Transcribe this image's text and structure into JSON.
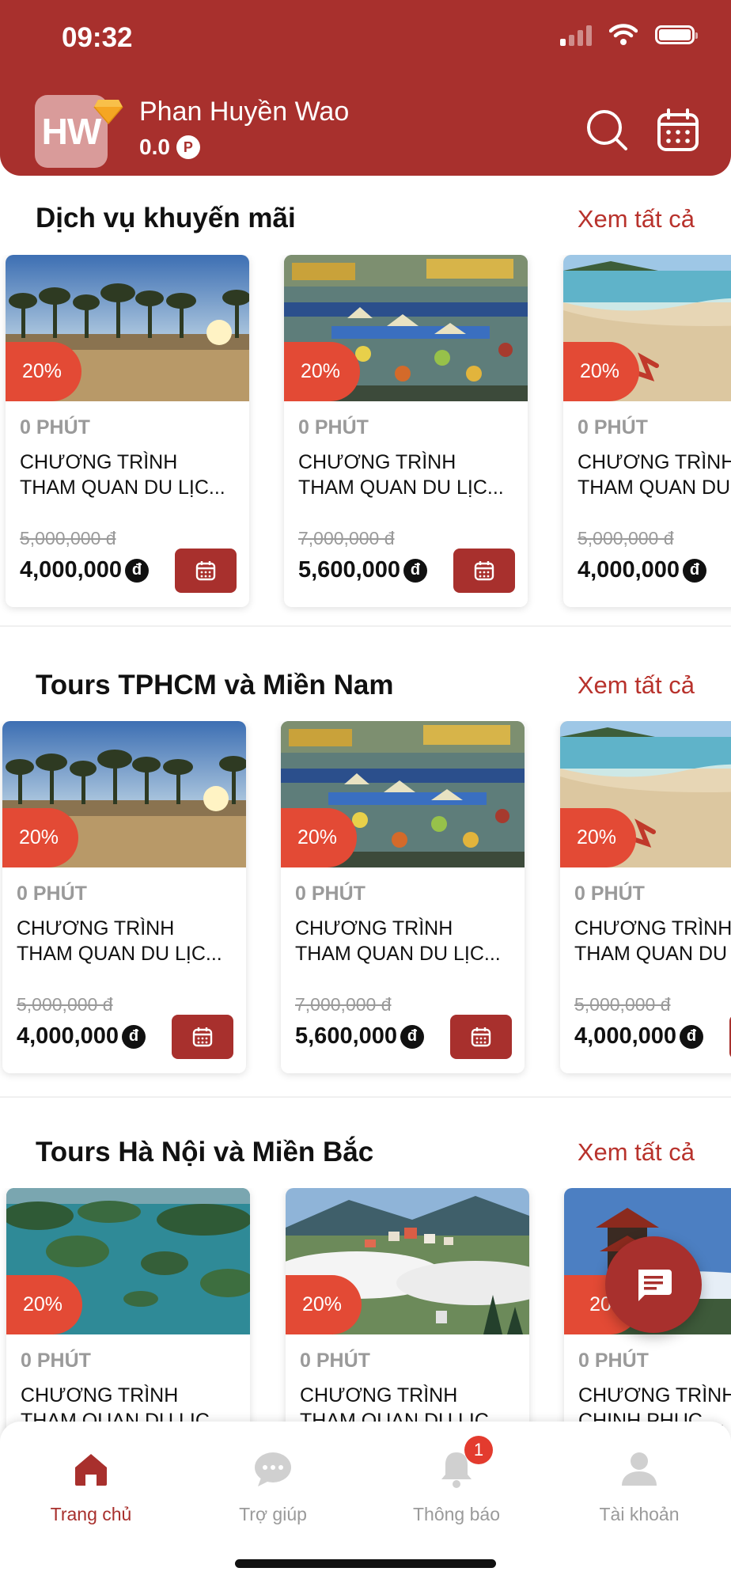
{
  "status_bar": {
    "time": "09:32"
  },
  "header": {
    "avatar_initials": "HW",
    "user_name": "Phan Huyền Wao",
    "points": "0.0",
    "points_symbol": "P"
  },
  "sections": [
    {
      "title": "Dịch vụ khuyến mãi",
      "see_all": "Xem tất cả",
      "cards": [
        {
          "image": "pine-forest-sunrise",
          "discount": "20%",
          "duration": "0 PHÚT",
          "title": "CHƯƠNG TRÌNH\nTHAM QUAN DU LỊC...",
          "price_old": "5,000,000 đ",
          "price_new": "4,000,000",
          "currency": "đ"
        },
        {
          "image": "floating-market",
          "discount": "20%",
          "duration": "0 PHÚT",
          "title": "CHƯƠNG TRÌNH\nTHAM QUAN DU LỊC...",
          "price_old": "7,000,000 đ",
          "price_new": "5,600,000",
          "currency": "đ"
        },
        {
          "image": "beach",
          "discount": "20%",
          "duration": "0 PHÚT",
          "title": "CHƯƠNG TRÌNH\nTHAM QUAN DU",
          "price_old": "5,000,000 đ",
          "price_new": "4,000,000",
          "currency": "đ"
        }
      ]
    },
    {
      "title": "Tours TPHCM và Miền Nam",
      "see_all": "Xem tất cả",
      "cards": [
        {
          "image": "pine-forest-sunrise",
          "discount": "20%",
          "duration": "0 PHÚT",
          "title": "CHƯƠNG TRÌNH\nTHAM QUAN DU LỊC...",
          "price_old": "5,000,000 đ",
          "price_new": "4,000,000",
          "currency": "đ"
        },
        {
          "image": "floating-market",
          "discount": "20%",
          "duration": "0 PHÚT",
          "title": "CHƯƠNG TRÌNH\nTHAM QUAN DU LỊC...",
          "price_old": "7,000,000 đ",
          "price_new": "5,600,000",
          "currency": "đ"
        },
        {
          "image": "beach",
          "discount": "20%",
          "duration": "0 PHÚT",
          "title": "CHƯƠNG TRÌNH\nTHAM QUAN DU",
          "price_old": "5,000,000 đ",
          "price_new": "4,000,000",
          "currency": "đ"
        }
      ]
    },
    {
      "title": "Tours Hà Nội và Miền Bắc",
      "see_all": "Xem tất cả",
      "cards": [
        {
          "image": "ha-long-bay",
          "discount": "20%",
          "duration": "0 PHÚT",
          "title": "CHƯƠNG TRÌNH\nTHAM QUAN DU LỊC...",
          "price_old": "",
          "price_new": "",
          "currency": ""
        },
        {
          "image": "sapa-clouds",
          "discount": "20%",
          "duration": "0 PHÚT",
          "title": "CHƯƠNG TRÌNH\nTHAM QUAN DU LỊC...",
          "price_old": "",
          "price_new": "",
          "currency": ""
        },
        {
          "image": "fansipan-pagoda",
          "discount": "20",
          "duration": "0 PHÚT",
          "title": "CHƯƠNG TRÌNH\nCHINH PHỤC ...",
          "price_old": "",
          "price_new": "",
          "currency": ""
        }
      ]
    }
  ],
  "tab_bar": {
    "items": [
      {
        "label": "Trang chủ",
        "icon": "home-icon",
        "active": true
      },
      {
        "label": "Trợ giúp",
        "icon": "chat-bubble-icon",
        "active": false
      },
      {
        "label": "Thông báo",
        "icon": "bell-icon",
        "active": false,
        "badge": "1"
      },
      {
        "label": "Tài khoản",
        "icon": "user-icon",
        "active": false
      }
    ]
  },
  "colors": {
    "primary": "#a8302d",
    "discount_badge": "#e34a35",
    "muted_text": "#9a9a9a"
  }
}
